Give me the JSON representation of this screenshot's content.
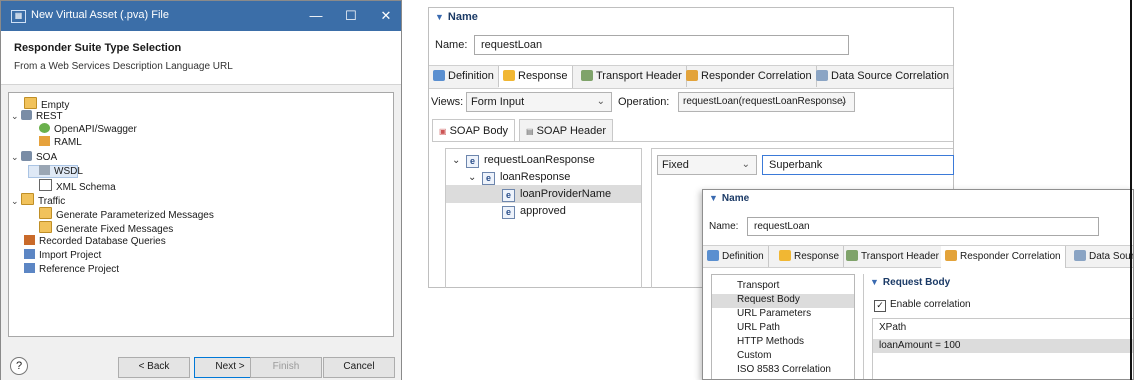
{
  "wizard": {
    "title": "New Virtual Asset (.pva) File",
    "header_title": "Responder Suite Type Selection",
    "header_subtitle": "From a Web Services Description Language URL",
    "tree": {
      "empty": "Empty",
      "rest": "REST",
      "openapi": "OpenAPI/Swagger",
      "raml": "RAML",
      "soa": "SOA",
      "wsdl": "WSDL",
      "xml_schema": "XML Schema",
      "traffic": "Traffic",
      "gen_param": "Generate Parameterized Messages",
      "gen_fixed": "Generate Fixed Messages",
      "recorded_db": "Recorded Database Queries",
      "import_project": "Import Project",
      "reference_project": "Reference Project"
    },
    "buttons": {
      "help": "?",
      "back": "< Back",
      "next": "Next >",
      "finish": "Finish",
      "cancel": "Cancel"
    }
  },
  "editor1": {
    "section": "Name",
    "name_label": "Name:",
    "name_value": "requestLoan",
    "tabs": [
      "Definition",
      "Response",
      "Transport Header",
      "Responder Correlation",
      "Data Source Correlation"
    ],
    "views_label": "Views:",
    "views_value": "Form Input",
    "operation_label": "Operation:",
    "operation_value": "requestLoan(requestLoanResponse)",
    "subtabs": [
      "SOAP Body",
      "SOAP Header"
    ],
    "tree": [
      "requestLoanResponse",
      "loanResponse",
      "loanProviderName",
      "approved"
    ],
    "tree_badge": "e",
    "value_mode": "Fixed",
    "value": "Superbank"
  },
  "editor2": {
    "section": "Name",
    "name_label": "Name:",
    "name_value": "requestLoan",
    "tabs": [
      "Definition",
      "Response",
      "Transport Header",
      "Responder Correlation",
      "Data Sour"
    ],
    "left_list": [
      "Transport",
      "Request Body",
      "URL Parameters",
      "URL Path",
      "HTTP Methods",
      "Custom",
      "ISO 8583 Correlation"
    ],
    "request_body_title": "Request Body",
    "enable_correlation": "Enable correlation",
    "enable_checked": true,
    "xpath_header": "XPath",
    "xpath_row": "loanAmount = 100"
  },
  "colors": {
    "titlebar": "#3b6ea8",
    "selection": "#dcdcdc",
    "section_header": "#1b3a66"
  }
}
